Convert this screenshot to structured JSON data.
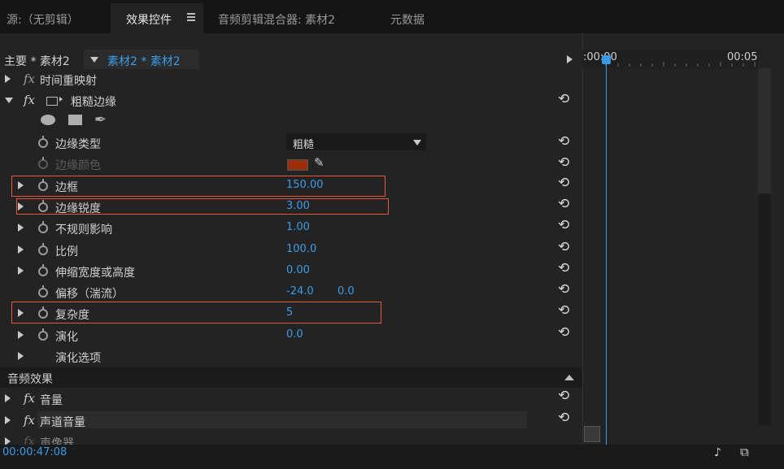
{
  "tabs": {
    "source": "源:（无剪辑）",
    "effect_controls": "效果控件",
    "audio_mixer": "音频剪辑混合器: 素材2",
    "metadata": "元数据"
  },
  "breadcrumb": {
    "master": "主要 * 素材2",
    "clip": "素材2 * 素材2"
  },
  "timeline": {
    "start_label": ":00:00",
    "end_label": "00:05",
    "accent": "#3a9ae6"
  },
  "effects": {
    "time_remap": "时间重映射",
    "roughen_edges": "粗糙边缘",
    "params": {
      "edge_type": {
        "label": "边缘类型",
        "value": "粗糙"
      },
      "edge_color": {
        "label": "边缘颜色",
        "color": "#9b2f0c"
      },
      "border": {
        "label": "边框",
        "value": "150.00"
      },
      "edge_sharpness": {
        "label": "边缘锐度",
        "value": "3.00"
      },
      "fractal_influence": {
        "label": "不规则影响",
        "value": "1.00"
      },
      "scale": {
        "label": "比例",
        "value": "100.0"
      },
      "stretch": {
        "label": "伸缩宽度或高度",
        "value": "0.00"
      },
      "offset": {
        "label": "偏移（湍流）",
        "value_x": "-24.0",
        "value_y": "0.0"
      },
      "complexity": {
        "label": "复杂度",
        "value": "5"
      },
      "evolution": {
        "label": "演化",
        "value": "0.0"
      },
      "evolution_options": {
        "label": "演化选项"
      }
    }
  },
  "audio": {
    "header": "音频效果",
    "volume": "音量",
    "channel_volume": "声道音量",
    "panner": "声像器"
  },
  "footer": {
    "timecode": "00:00:47:08"
  },
  "highlight_color": "#e8553a"
}
